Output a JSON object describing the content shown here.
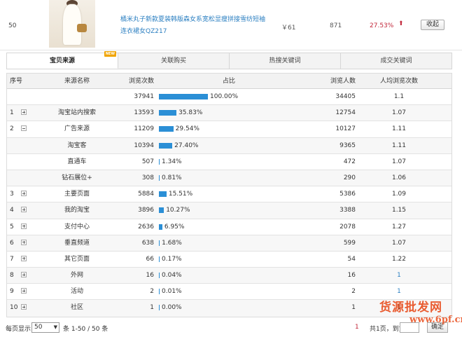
{
  "product": {
    "rank": "50",
    "title": "橘米丸子新款夏装韩版森女系宽松显瘦拼接雪纺短袖连衣裙女QZ217",
    "price": "￥61",
    "views": "871",
    "change": "27.53%",
    "change_icon": "arrow-up-icon",
    "collapse_label": "收起"
  },
  "tabs": [
    {
      "label": "宝贝来源",
      "active": true,
      "badge": "NEW"
    },
    {
      "label": "关联购买",
      "active": false
    },
    {
      "label": "热搜关键词",
      "active": false
    },
    {
      "label": "成交关键词",
      "active": false
    }
  ],
  "table": {
    "headers": {
      "idx": "序号",
      "name": "来源名称",
      "views": "浏览次数",
      "share": "占比",
      "users": "浏览人数",
      "avg": "人均浏览次数"
    },
    "rows": [
      {
        "idx": "",
        "expander": "",
        "name": "",
        "views": "37941",
        "share": "100.00%",
        "share_value": 100.0,
        "users": "34405",
        "avg": "1.1"
      },
      {
        "idx": "1",
        "expander": "plus",
        "name": "淘宝站内搜索",
        "views": "13593",
        "share": "35.83%",
        "share_value": 35.83,
        "users": "12754",
        "avg": "1.07"
      },
      {
        "idx": "2",
        "expander": "minus",
        "name": "广告来源",
        "views": "11209",
        "share": "29.54%",
        "share_value": 29.54,
        "users": "10127",
        "avg": "1.11"
      },
      {
        "idx": "",
        "expander": "",
        "name": "淘宝客",
        "views": "10394",
        "share": "27.40%",
        "share_value": 27.4,
        "users": "9365",
        "avg": "1.11"
      },
      {
        "idx": "",
        "expander": "",
        "name": "直通车",
        "views": "507",
        "share": "1.34%",
        "share_value": 1.34,
        "users": "472",
        "avg": "1.07"
      },
      {
        "idx": "",
        "expander": "",
        "name": "钻石展位+",
        "views": "308",
        "share": "0.81%",
        "share_value": 0.81,
        "users": "290",
        "avg": "1.06"
      },
      {
        "idx": "3",
        "expander": "plus",
        "name": "主要页面",
        "views": "5884",
        "share": "15.51%",
        "share_value": 15.51,
        "users": "5386",
        "avg": "1.09"
      },
      {
        "idx": "4",
        "expander": "plus",
        "name": "我的淘宝",
        "views": "3896",
        "share": "10.27%",
        "share_value": 10.27,
        "users": "3388",
        "avg": "1.15"
      },
      {
        "idx": "5",
        "expander": "plus",
        "name": "支付中心",
        "views": "2636",
        "share": "6.95%",
        "share_value": 6.95,
        "users": "2078",
        "avg": "1.27"
      },
      {
        "idx": "6",
        "expander": "plus",
        "name": "垂直频道",
        "views": "638",
        "share": "1.68%",
        "share_value": 1.68,
        "users": "599",
        "avg": "1.07"
      },
      {
        "idx": "7",
        "expander": "plus",
        "name": "其它页面",
        "views": "66",
        "share": "0.17%",
        "share_value": 0.17,
        "users": "54",
        "avg": "1.22"
      },
      {
        "idx": "8",
        "expander": "plus",
        "name": "外网",
        "views": "16",
        "share": "0.04%",
        "share_value": 0.04,
        "users": "16",
        "avg": "1"
      },
      {
        "idx": "9",
        "expander": "plus",
        "name": "活动",
        "views": "2",
        "share": "0.01%",
        "share_value": 0.01,
        "users": "2",
        "avg": "1"
      },
      {
        "idx": "10",
        "expander": "plus",
        "name": "社区",
        "views": "1",
        "share": "0.00%",
        "share_value": 0.0,
        "users": "1",
        "avg": "1"
      }
    ]
  },
  "footer": {
    "per_page_label": "每页显示",
    "per_page_value": "50",
    "range_text": "条 1-50 / 50 条",
    "current_page": "1",
    "total_pages_text": "共1页，到第",
    "confirm_label": "确定"
  },
  "watermark": {
    "text": "货源批发网",
    "url_text": "www.6pf.cn"
  },
  "colors": {
    "bar": "#2b8fd6",
    "link": "#2b7fc1",
    "up": "#c2273a"
  }
}
